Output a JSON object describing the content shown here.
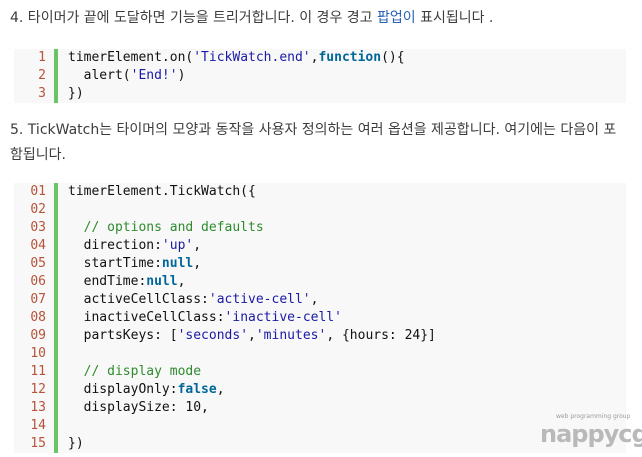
{
  "para4": {
    "before": "4. 타이머가 끝에 도달하면 기능을 트리거합니다. 이 경우 경고 ",
    "link": "팝업이",
    "after": " 표시됩니다 ."
  },
  "para5": {
    "text": "5. TickWatch는 타이머의 모양과 동작을 사용자 정의하는 여러 옵션을 제공합니다. 여기에는 다음이 포함됩니다."
  },
  "code1": {
    "lines": [
      {
        "num": "1",
        "tokens": [
          {
            "t": "timerElement.on(",
            "c": "p"
          },
          {
            "t": "'TickWatch.end'",
            "c": "s"
          },
          {
            "t": ",",
            "c": "p"
          },
          {
            "t": "function",
            "c": "k"
          },
          {
            "t": "(){",
            "c": "p"
          }
        ]
      },
      {
        "num": "2",
        "tokens": [
          {
            "t": "  alert(",
            "c": "p"
          },
          {
            "t": "'End!'",
            "c": "s"
          },
          {
            "t": ")",
            "c": "p"
          }
        ]
      },
      {
        "num": "3",
        "tokens": [
          {
            "t": "})",
            "c": "p"
          }
        ]
      }
    ]
  },
  "code2": {
    "lines": [
      {
        "num": "01",
        "tokens": [
          {
            "t": "timerElement.TickWatch({",
            "c": "p"
          }
        ]
      },
      {
        "num": "02",
        "tokens": []
      },
      {
        "num": "03",
        "tokens": [
          {
            "t": "  // options and defaults",
            "c": "c"
          }
        ]
      },
      {
        "num": "04",
        "tokens": [
          {
            "t": "  direction:",
            "c": "p"
          },
          {
            "t": "'up'",
            "c": "s"
          },
          {
            "t": ",",
            "c": "p"
          }
        ]
      },
      {
        "num": "05",
        "tokens": [
          {
            "t": "  startTime:",
            "c": "p"
          },
          {
            "t": "null",
            "c": "k"
          },
          {
            "t": ",",
            "c": "p"
          }
        ]
      },
      {
        "num": "06",
        "tokens": [
          {
            "t": "  endTime:",
            "c": "p"
          },
          {
            "t": "null",
            "c": "k"
          },
          {
            "t": ",",
            "c": "p"
          }
        ]
      },
      {
        "num": "07",
        "tokens": [
          {
            "t": "  activeCellClass:",
            "c": "p"
          },
          {
            "t": "'active-cell'",
            "c": "s"
          },
          {
            "t": ",",
            "c": "p"
          }
        ]
      },
      {
        "num": "08",
        "tokens": [
          {
            "t": "  inactiveCellClass:",
            "c": "p"
          },
          {
            "t": "'inactive-cell'",
            "c": "s"
          }
        ]
      },
      {
        "num": "09",
        "tokens": [
          {
            "t": "  partsKeys: [",
            "c": "p"
          },
          {
            "t": "'seconds'",
            "c": "s"
          },
          {
            "t": ",",
            "c": "p"
          },
          {
            "t": "'minutes'",
            "c": "s"
          },
          {
            "t": ", {hours: 24}]",
            "c": "p"
          }
        ]
      },
      {
        "num": "10",
        "tokens": []
      },
      {
        "num": "11",
        "tokens": [
          {
            "t": "  // display mode",
            "c": "c"
          }
        ]
      },
      {
        "num": "12",
        "tokens": [
          {
            "t": "  displayOnly:",
            "c": "p"
          },
          {
            "t": "false",
            "c": "k"
          },
          {
            "t": ",",
            "c": "p"
          }
        ]
      },
      {
        "num": "13",
        "tokens": [
          {
            "t": "  displaySize: 10,",
            "c": "p"
          }
        ]
      },
      {
        "num": "14",
        "tokens": []
      },
      {
        "num": "15",
        "tokens": [
          {
            "t": "})",
            "c": "p"
          }
        ]
      }
    ]
  },
  "watermark": {
    "tagline": "web programming group",
    "wordmark": "nappycgi"
  },
  "colors": {
    "link": "#2b63b5",
    "gutter_bar": "#6ac46a",
    "line_number": "#b5543a",
    "string": "#1a1aa6",
    "keyword": "#00679a",
    "comment": "#2e8b2e"
  }
}
